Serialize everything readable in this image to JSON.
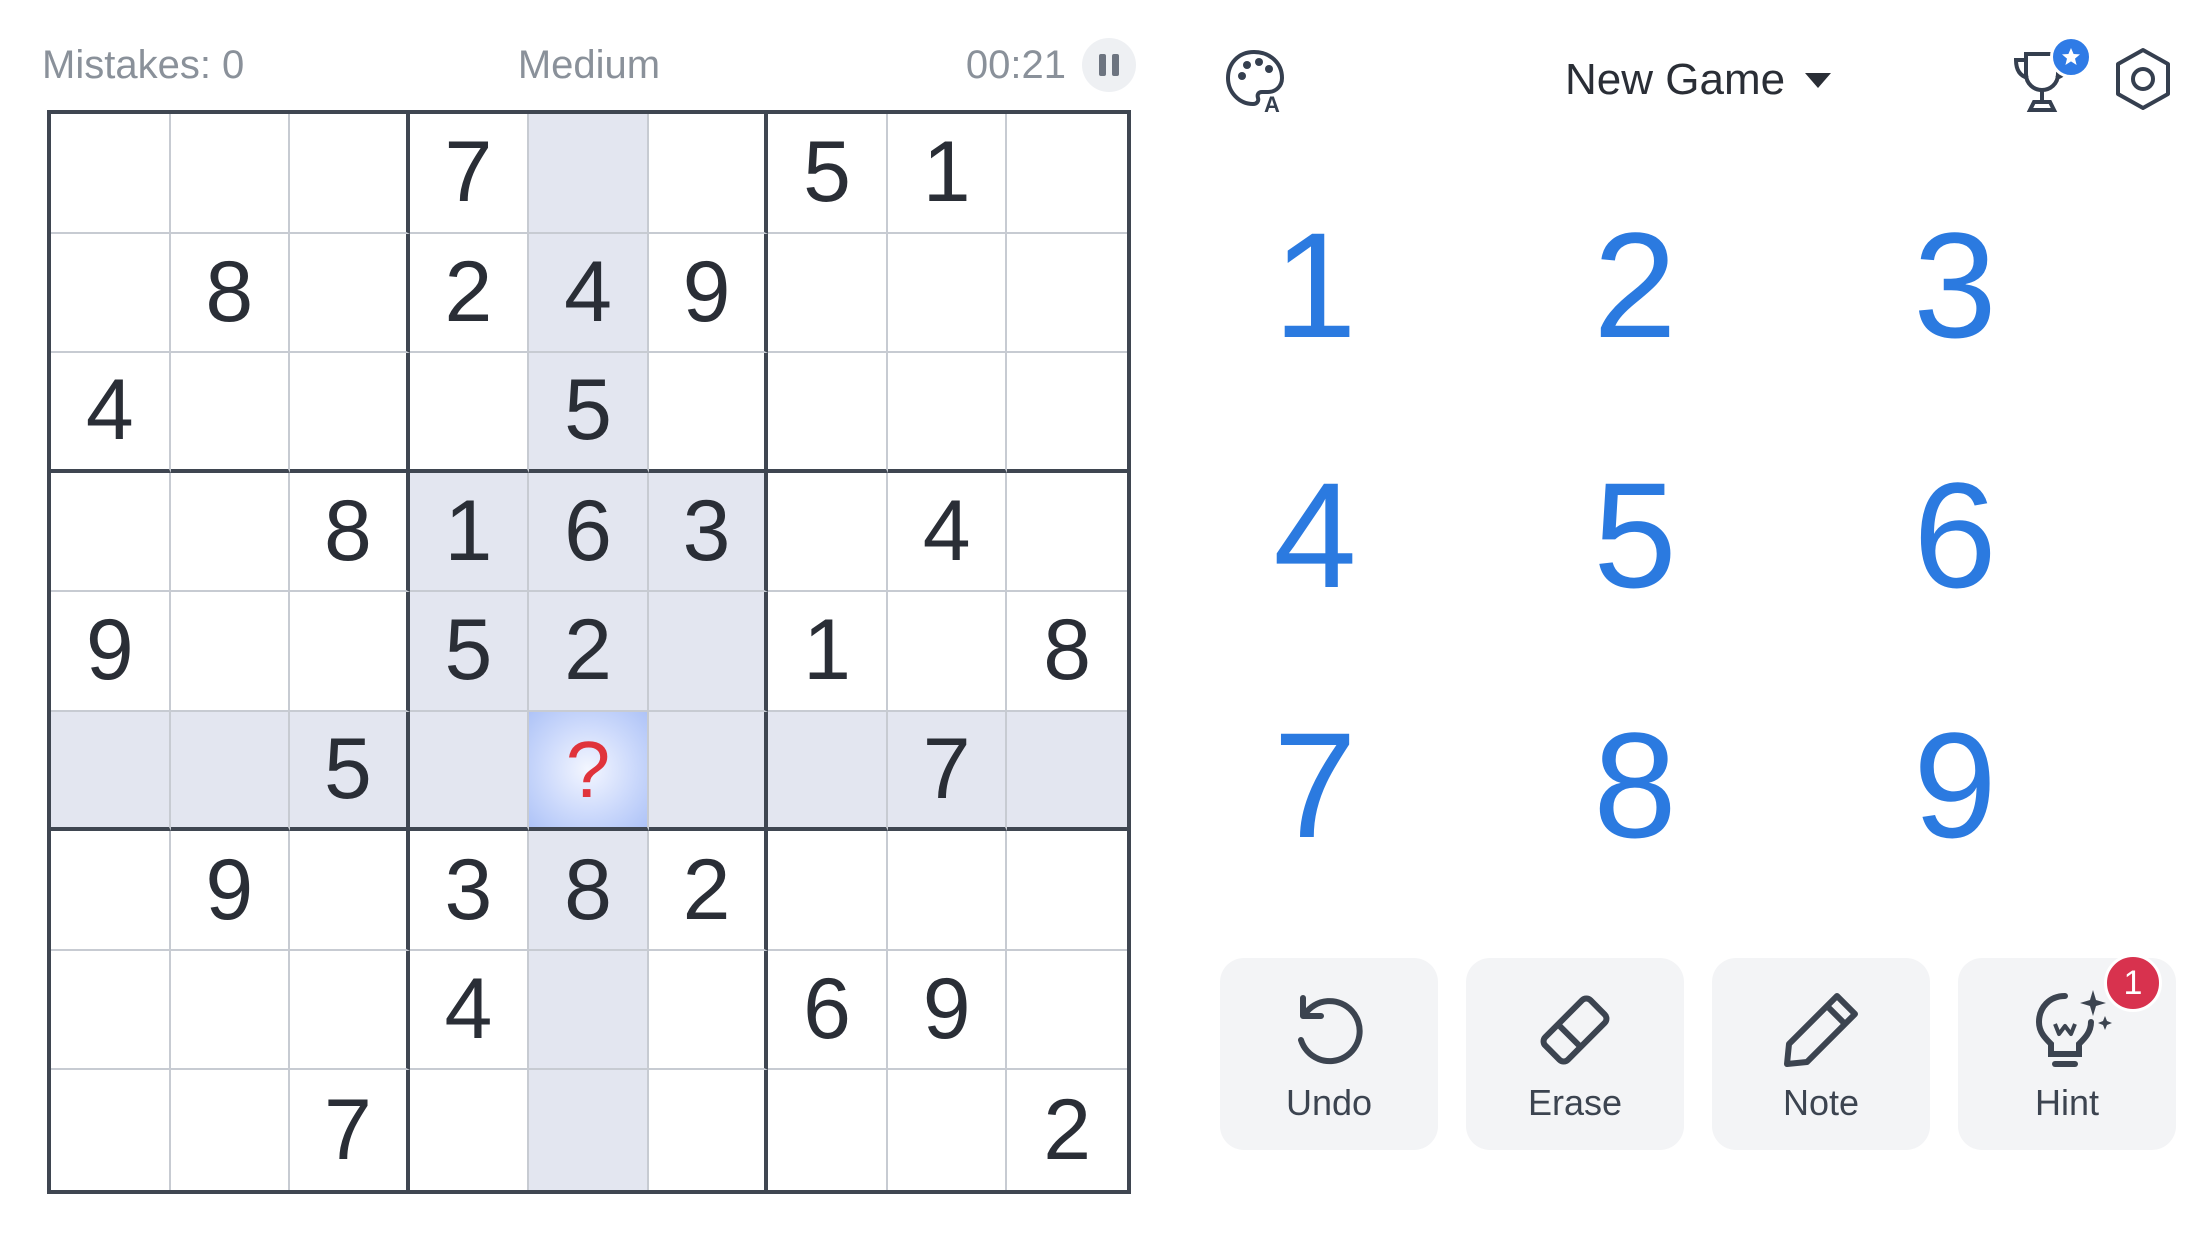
{
  "status": {
    "mistakes": "Mistakes: 0",
    "difficulty": "Medium",
    "timer": "00:21"
  },
  "board": [
    [
      "",
      "",
      "",
      "7",
      "",
      "",
      "5",
      "1",
      ""
    ],
    [
      "",
      "8",
      "",
      "2",
      "4",
      "9",
      "",
      "",
      ""
    ],
    [
      "4",
      "",
      "",
      "",
      "5",
      "",
      "",
      "",
      ""
    ],
    [
      "",
      "",
      "8",
      "1",
      "6",
      "3",
      "",
      "4",
      ""
    ],
    [
      "9",
      "",
      "",
      "5",
      "2",
      "",
      "1",
      "",
      "8"
    ],
    [
      "",
      "",
      "5",
      "",
      "?",
      "",
      "",
      "7",
      ""
    ],
    [
      "",
      "9",
      "",
      "3",
      "8",
      "2",
      "",
      "",
      ""
    ],
    [
      "",
      "",
      "",
      "4",
      "",
      "",
      "6",
      "9",
      ""
    ],
    [
      "",
      "",
      "7",
      "",
      "",
      "",
      "",
      "",
      "2"
    ]
  ],
  "header": {
    "new_game_label": "New Game"
  },
  "numpad": [
    "1",
    "2",
    "3",
    "4",
    "5",
    "6",
    "7",
    "8",
    "9"
  ],
  "tools": {
    "undo": "Undo",
    "erase": "Erase",
    "note": "Note",
    "hint": "Hint",
    "hint_count": "1"
  },
  "icons": {
    "palette": "palette-icon",
    "trophy": "trophy-icon",
    "settings": "settings-icon",
    "undo": "undo-icon",
    "erase": "eraser-icon",
    "note": "pencil-icon",
    "hint": "lightbulb-icon"
  },
  "colors": {
    "accent": "#2b7ae0",
    "highlight": "#e3e6f0",
    "selected": "#c9d7fb",
    "error": "#e0333b",
    "badge": "#d8324e"
  }
}
